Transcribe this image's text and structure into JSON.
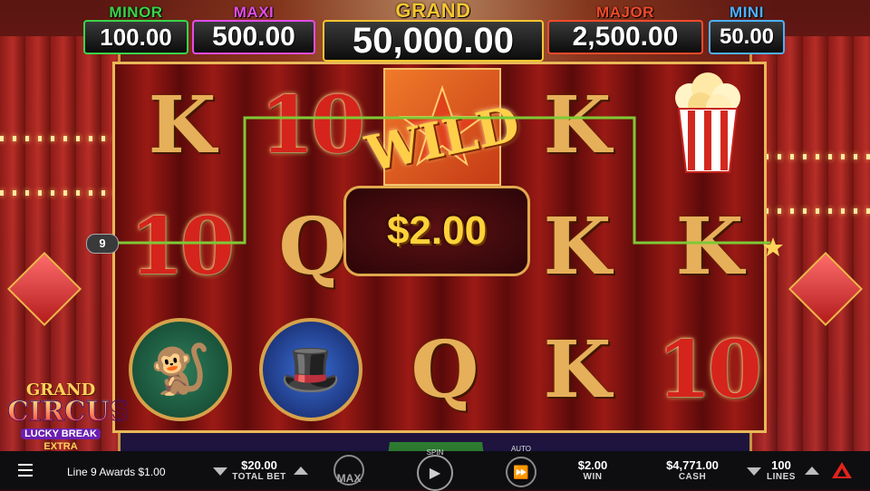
{
  "jackpots": [
    {
      "id": "minor",
      "label": "MINOR",
      "amount": "100.00",
      "color": "#39d449"
    },
    {
      "id": "maxi",
      "label": "MAXI",
      "amount": "500.00",
      "color": "#e24ce8"
    },
    {
      "id": "grand",
      "label": "GRAND",
      "amount": "50,000.00",
      "color": "#f7c531"
    },
    {
      "id": "major",
      "label": "MAJOR",
      "amount": "2,500.00",
      "color": "#f24a2b"
    },
    {
      "id": "mini",
      "label": "MINI",
      "amount": "50.00",
      "color": "#4db0ff"
    }
  ],
  "reels": {
    "row1": [
      "K",
      "10",
      "WILD",
      "K",
      "popcorn"
    ],
    "row2": [
      "10",
      "Q",
      "$2.00",
      "K",
      "K"
    ],
    "row3": [
      "monkey",
      "ringmaster",
      "Q",
      "K",
      "10"
    ]
  },
  "wild": {
    "label": "WILD",
    "win_amount": "$2.00"
  },
  "payline": {
    "number": "9"
  },
  "logo": {
    "line1": "GRAND",
    "line2": "CIRCUS",
    "line3": "LUCKY BREAK",
    "line4": "EXTRA"
  },
  "bottom_bar": {
    "message": "Line 9 Awards $1.00",
    "total_bet": {
      "value": "$20.00",
      "label": "TOTAL BET"
    },
    "max_label": "MAX",
    "spin_label": "SPIN",
    "auto_label": "AUTO",
    "win": {
      "value": "$2.00",
      "label": "WIN"
    },
    "cash": {
      "value": "$4,771.00",
      "label": "CASH"
    },
    "lines": {
      "value": "100",
      "label": "LINES"
    }
  }
}
